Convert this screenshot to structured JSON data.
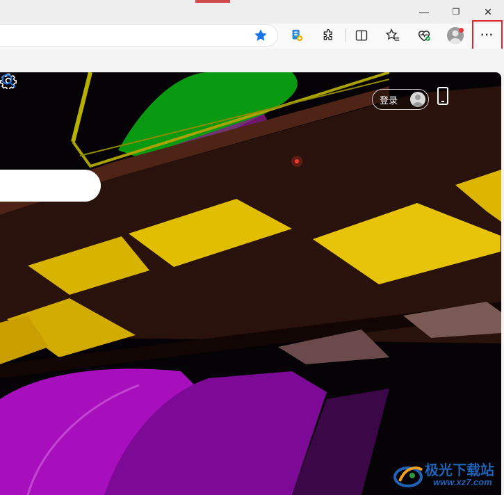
{
  "window": {
    "minimize_glyph": "—",
    "restore_glyph": "❐",
    "close_glyph": "✕"
  },
  "toolbar": {
    "more_label": "···",
    "icons": [
      "favorite-star-icon",
      "bing-chat-icon",
      "extensions-icon",
      "split-screen-icon",
      "favorites-icon",
      "browser-essentials-icon",
      "profile-icon",
      "more-options-icon"
    ]
  },
  "page": {
    "login_label": "登录"
  },
  "watermark": {
    "brand": "极光下载站",
    "url": "www.xz7.com"
  },
  "colors": {
    "accent_blue": "#1a73e8",
    "highlight_red": "#e0262b",
    "watermark_blue": "#1e63b8"
  }
}
